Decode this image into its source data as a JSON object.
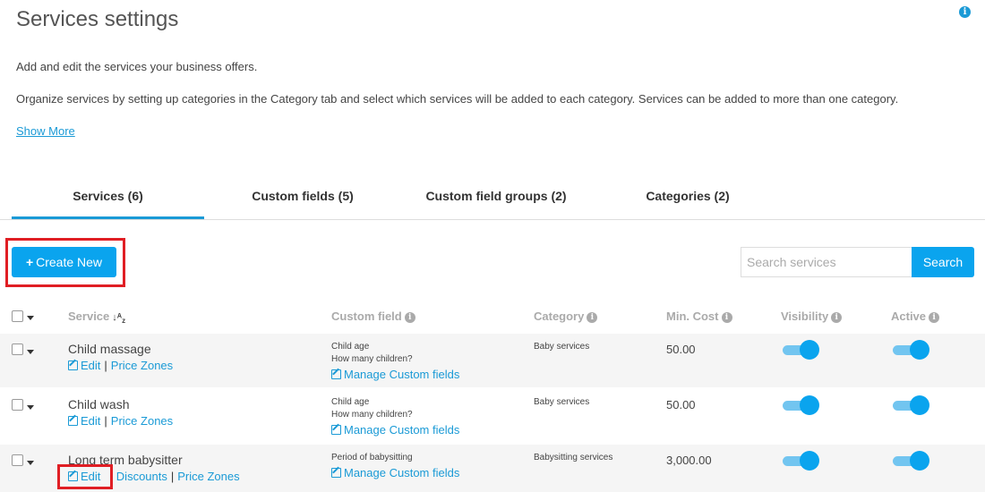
{
  "page": {
    "title": "Services settings",
    "description_1": "Add and edit the services your business offers.",
    "description_2": "Organize services by setting up categories in the Category tab and select which services will be added to each category. Services can be added to more than one category.",
    "show_more": "Show More",
    "info_icon": "i"
  },
  "tabs": [
    {
      "label": "Services (6)",
      "active": true
    },
    {
      "label": "Custom fields (5)",
      "active": false
    },
    {
      "label": "Custom field groups (2)",
      "active": false
    },
    {
      "label": "Categories (2)",
      "active": false
    }
  ],
  "toolbar": {
    "create_label": "Create New",
    "create_plus": "+",
    "search_placeholder": "Search services",
    "search_label": "Search"
  },
  "table": {
    "headers": {
      "service": "Service",
      "sort_icon": "↓A Z",
      "custom_field": "Custom field",
      "category": "Category",
      "min_cost": "Min. Cost",
      "visibility": "Visibility",
      "active": "Active"
    },
    "rows": [
      {
        "name": "Child massage",
        "links": [
          "Edit",
          "Price Zones"
        ],
        "custom_fields": [
          "Child age",
          "How many children?"
        ],
        "manage": "Manage Custom fields",
        "category": "Baby services",
        "min_cost": "50.00",
        "visible": true,
        "active": true
      },
      {
        "name": "Child wash",
        "links": [
          "Edit",
          "Price Zones"
        ],
        "custom_fields": [
          "Child age",
          "How many children?"
        ],
        "manage": "Manage Custom fields",
        "category": "Baby services",
        "min_cost": "50.00",
        "visible": true,
        "active": true
      },
      {
        "name": "Long term babysitter",
        "links": [
          "Edit",
          "Discounts",
          "Price Zones"
        ],
        "custom_fields": [
          "Period of babysitting"
        ],
        "manage": "Manage Custom fields",
        "category": "Babysitting services",
        "min_cost": "3,000.00",
        "visible": true,
        "active": true
      }
    ]
  },
  "colors": {
    "accent": "#0aa4ee",
    "link": "#1a9ad6",
    "highlight": "#e01e24"
  }
}
